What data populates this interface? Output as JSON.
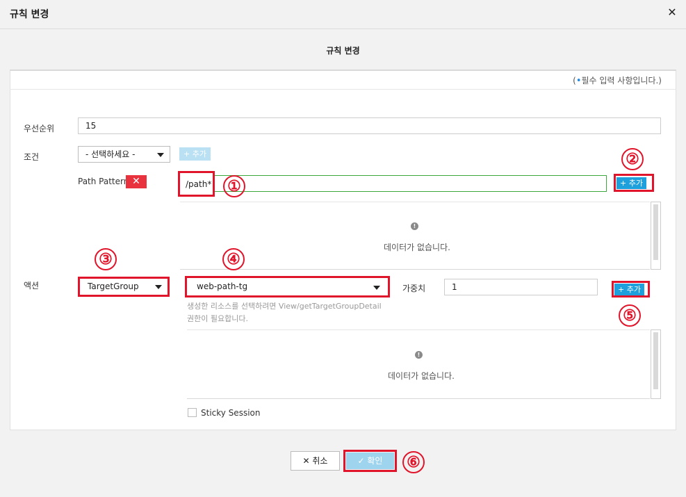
{
  "header": {
    "title": "규칙 변경",
    "close_glyph": "✕"
  },
  "section_title": "규칙 변경",
  "required_note": {
    "open": "(",
    "dot": "•",
    "text": "필수 입력 사항입니다.)"
  },
  "priority": {
    "label": "우선순위",
    "value": "15"
  },
  "condition": {
    "label": "조건",
    "select_value": "- 선택하세요 -",
    "add_label": "+ 추가",
    "path_pattern_label": "Path Pattern",
    "remove_glyph": "✕",
    "path_value": "/path*",
    "add_path_label": "+ 추가",
    "empty_text": "데이터가 없습니다."
  },
  "action": {
    "label": "액션",
    "type_value": "TargetGroup",
    "target_value": "web-path-tg",
    "weight_label": "가중치",
    "weight_value": "1",
    "add_label": "+ 추가",
    "help_line1": "생성한 리소스를 선택하려면 View/getTargetGroupDetail",
    "help_line2": "권한이 필요합니다.",
    "empty_text": "데이터가 없습니다.",
    "sticky_label": "Sticky Session"
  },
  "footer": {
    "cancel_label": "취소",
    "cancel_glyph": "✕",
    "ok_label": "확인",
    "ok_glyph": "✓"
  },
  "annotations": [
    "①",
    "②",
    "③",
    "④",
    "⑤",
    "⑥"
  ],
  "info_glyph": "!",
  "colors": {
    "accent": "#1ea0dc",
    "highlight": "#e0142a",
    "remove": "#e8323e",
    "focus_border": "#3aa83a"
  }
}
